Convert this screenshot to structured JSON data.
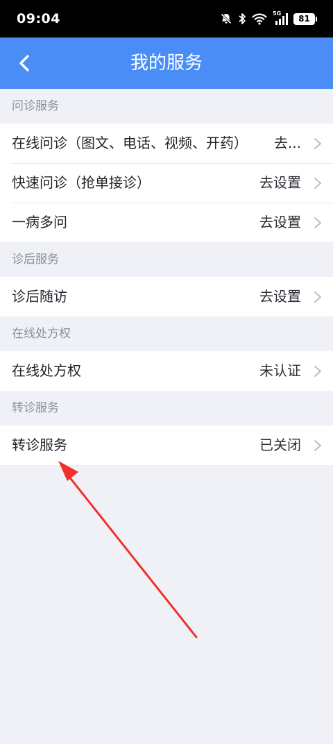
{
  "status_bar": {
    "time": "09:04",
    "network_label": "5G",
    "battery": "81"
  },
  "header": {
    "title": "我的服务",
    "back_icon": "chevron-left-icon"
  },
  "sections": [
    {
      "title": "问诊服务",
      "rows": [
        {
          "label": "在线问诊（图文、电话、视频、开药）",
          "value": "去..."
        },
        {
          "label": "快速问诊（抢单接诊）",
          "value": "去设置"
        },
        {
          "label": "一病多问",
          "value": "去设置"
        }
      ]
    },
    {
      "title": "诊后服务",
      "rows": [
        {
          "label": "诊后随访",
          "value": "去设置"
        }
      ]
    },
    {
      "title": "在线处方权",
      "rows": [
        {
          "label": "在线处方权",
          "value": "未认证"
        }
      ]
    },
    {
      "title": "转诊服务",
      "rows": [
        {
          "label": "转诊服务",
          "value": "已关闭"
        }
      ]
    }
  ],
  "colors": {
    "header_bg": "#4a8df7",
    "page_bg": "#eff1f6",
    "annotation_arrow": "#f0302a"
  }
}
